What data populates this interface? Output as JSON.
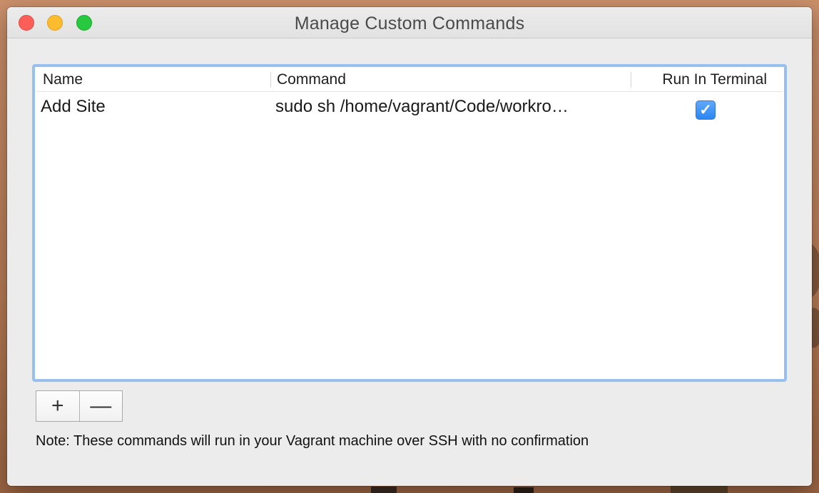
{
  "window": {
    "title": "Manage Custom Commands"
  },
  "table": {
    "columns": [
      "Name",
      "Command",
      "Run In Terminal"
    ],
    "rows": [
      {
        "name": "Add Site",
        "command": "sudo sh /home/vagrant/Code/workro…",
        "run_in_terminal": true
      }
    ]
  },
  "buttons": {
    "add_label": "+",
    "remove_label": "—"
  },
  "note": "Note: These commands will run in your Vagrant machine over SSH with no confirmation",
  "colors": {
    "accent": "#2b86f3",
    "focus_ring": "#98c0ee",
    "close": "#fc5f57",
    "minimize": "#fdbc2e",
    "zoom": "#28c840"
  },
  "icons": {
    "checkmark": "checkmark-icon"
  }
}
